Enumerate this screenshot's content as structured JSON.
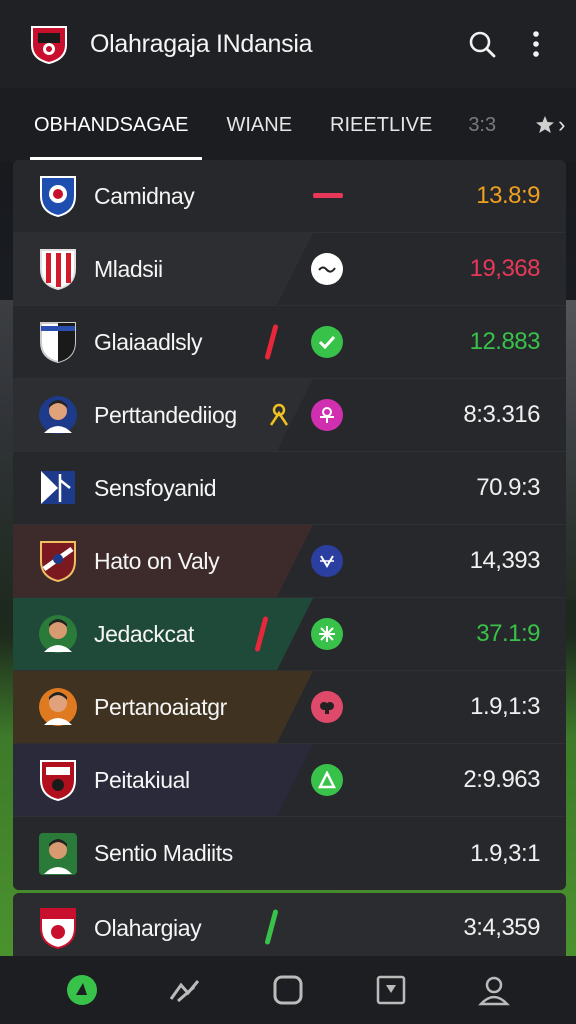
{
  "header": {
    "title": "Olahragaja INdansia",
    "logo_icon": "club-crest-icon",
    "search_icon": "search-icon",
    "menu_icon": "more-vertical-icon"
  },
  "tabs": [
    {
      "label": "OBHANDSAGAE",
      "active": true
    },
    {
      "label": "WIANE",
      "active": false
    },
    {
      "label": "RIEETLIVE",
      "active": false
    },
    {
      "label": "3:3",
      "active": false
    },
    {
      "label": "›",
      "active": false
    }
  ],
  "teams": [
    {
      "name": "Camidnay",
      "score": "13.8:9",
      "score_color": "#f0a020",
      "status": "red-dash",
      "crest": "blue-crest-icon"
    },
    {
      "name": "Mladsii",
      "score": "19,368",
      "score_color": "#e8385a",
      "status": "white-dot",
      "crest": "red-white-striped-crest-icon"
    },
    {
      "name": "Glaiaadlsly",
      "score": "12.883",
      "score_color": "#39c24a",
      "status": "green-check",
      "crest": "black-shield-crest-icon"
    },
    {
      "name": "Perttandediiog",
      "score": "8:3.316",
      "score_color": "#f0f0f0",
      "status": "pink-dot",
      "crest": "player-avatar-icon"
    },
    {
      "name": "Sensfoyanid",
      "score": "70.9:3",
      "score_color": "#f0f0f0",
      "status": "none",
      "crest": "blue-flag-crest-icon"
    },
    {
      "name": "Hato on Valy",
      "score": "14,393",
      "score_color": "#f0f0f0",
      "status": "blue-dot",
      "crest": "maroon-crest-icon"
    },
    {
      "name": "Jedackcat",
      "score": "37.1:9",
      "score_color": "#39c24a",
      "status": "green-dot",
      "crest": "player-avatar-icon"
    },
    {
      "name": "Pertanoaiatgr",
      "score": "1.9,1:3",
      "score_color": "#f0f0f0",
      "status": "rose-dot",
      "crest": "player-avatar-icon"
    },
    {
      "name": "Peitakiual",
      "score": "2:9.963",
      "score_color": "#f0f0f0",
      "status": "green-a",
      "crest": "red-crest-icon"
    },
    {
      "name": "Sentio Madiits",
      "score": "1.9,3:1",
      "score_color": "#f0f0f0",
      "status": "none",
      "crest": "player-avatar-icon"
    }
  ],
  "last_row": {
    "name": "Olahargiay",
    "score": "3:4,359",
    "crest": "red-crest-icon"
  },
  "bottom_nav": [
    {
      "icon": "live-icon",
      "active": true
    },
    {
      "icon": "stats-icon",
      "active": false
    },
    {
      "icon": "square-icon",
      "active": false
    },
    {
      "icon": "bookmark-icon",
      "active": false
    },
    {
      "icon": "profile-icon",
      "active": false
    }
  ],
  "colors": {
    "accent_green": "#39c24a",
    "accent_red": "#e8385a",
    "accent_orange": "#f0a020",
    "header_bg": "#1f2124"
  }
}
